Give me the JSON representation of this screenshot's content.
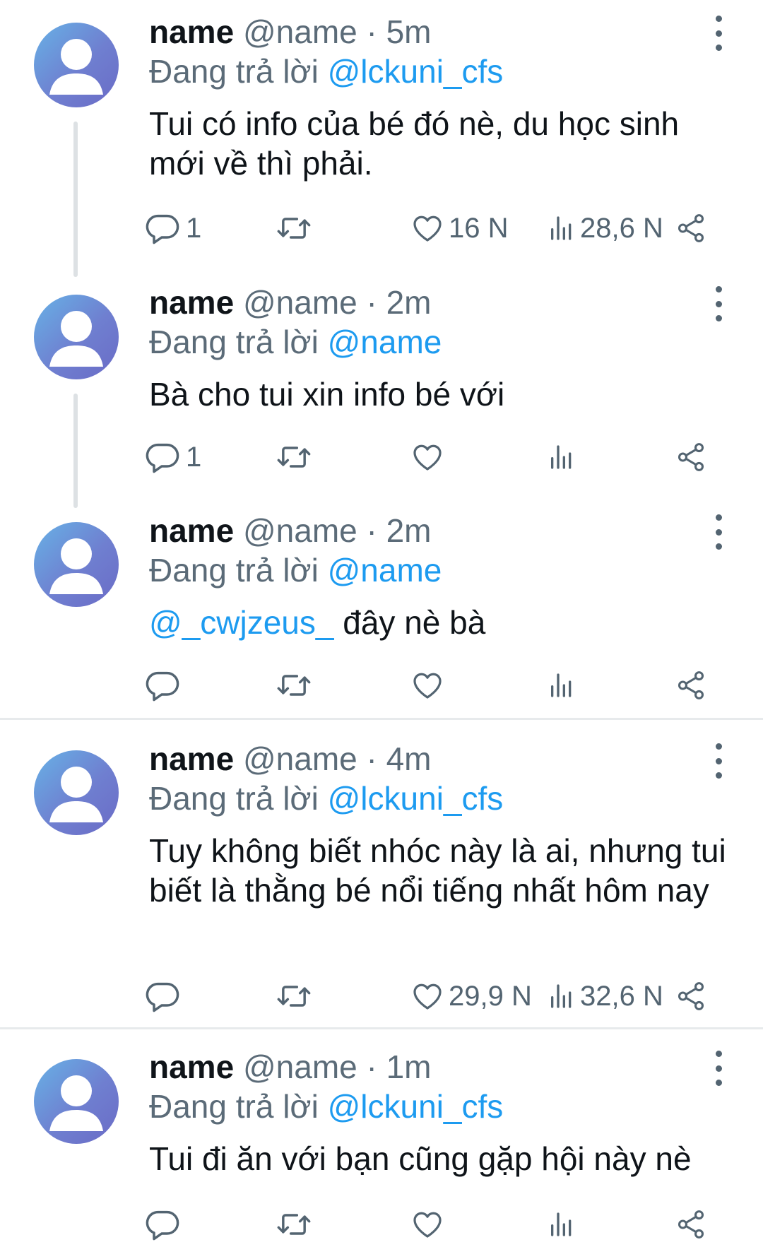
{
  "colors": {
    "link": "#1d9bf0",
    "muted": "#5b6b78",
    "icon": "#536471",
    "thread_line": "#dde1e4"
  },
  "icons": [
    "avatar-icon",
    "more-icon",
    "reply-icon",
    "retweet-icon",
    "like-icon",
    "views-icon",
    "share-icon"
  ],
  "tweets": [
    {
      "display_name": "name",
      "handle": "@name",
      "time": "· 5m",
      "reply_prefix": "Đang trả lời",
      "reply_to": "@lckuni_cfs",
      "mention": "",
      "text": "Tui có info của bé đó nè, du học sinh mới về thì phải.",
      "replies": "1",
      "retweets": "",
      "likes": "16 N",
      "views": "28,6 N"
    },
    {
      "display_name": "name",
      "handle": "@name",
      "time": "· 2m",
      "reply_prefix": "Đang trả lời",
      "reply_to": "@name",
      "mention": "",
      "text": "Bà cho tui xin info bé với",
      "replies": "1",
      "retweets": "",
      "likes": "",
      "views": ""
    },
    {
      "display_name": "name",
      "handle": "@name",
      "time": "· 2m",
      "reply_prefix": "Đang trả lời",
      "reply_to": "@name",
      "mention": "@_cwjzeus_",
      "text": " đây nè bà",
      "replies": "",
      "retweets": "",
      "likes": "",
      "views": ""
    },
    {
      "display_name": "name",
      "handle": "@name",
      "time": "· 4m",
      "reply_prefix": "Đang trả lời",
      "reply_to": "@lckuni_cfs",
      "mention": "",
      "text": "Tuy không biết nhóc này là ai, nhưng tui biết là thằng bé nổi tiếng nhất hôm nay",
      "replies": "",
      "retweets": "",
      "likes": "29,9 N",
      "views": "32,6 N"
    },
    {
      "display_name": "name",
      "handle": "@name",
      "time": "· 1m",
      "reply_prefix": "Đang trả lời",
      "reply_to": "@lckuni_cfs",
      "mention": "",
      "text": "Tui đi ăn với bạn cũng gặp hội này nè",
      "replies": "",
      "retweets": "",
      "likes": "",
      "views": ""
    }
  ]
}
